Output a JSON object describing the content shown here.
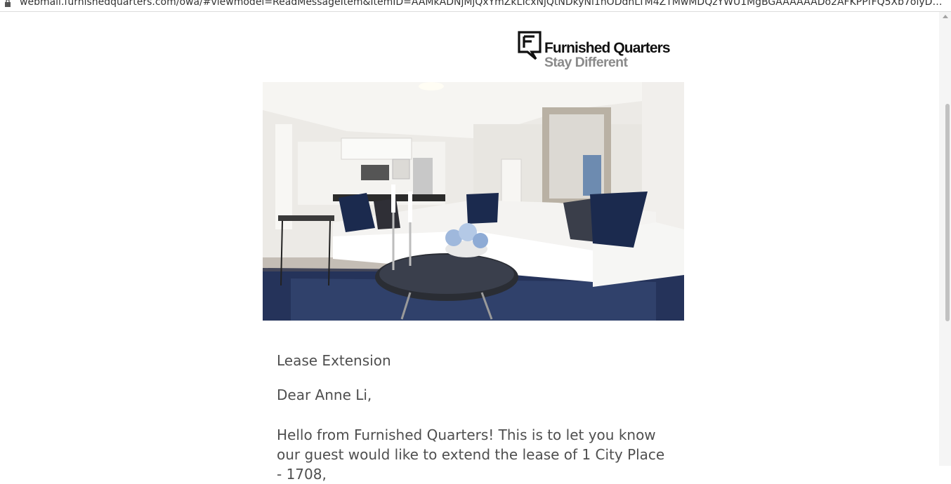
{
  "browser": {
    "url": "webmail.furnishedquarters.com/owa/#viewmodel=ReadMessageItem&ItemID=AAMkADNjMjQxYmZkLTcxNjQtNDkyNi1hODdhLTM4ZTMwMDQzYWU1MgBGAAAAAADo2AFKPPfFQ5Xb7oiyDbqOBwCEjdCSphIGTZ..."
  },
  "logo": {
    "brand": "Furnished Quarters",
    "tagline": "Stay Different"
  },
  "hero_image": {
    "description": "living-room"
  },
  "email": {
    "subject": "Lease Extension",
    "greeting": "Dear Anne Li,",
    "body": "Hello from Furnished Quarters! This is to let you know our guest would like to extend the lease of 1 City Place - 1708,"
  },
  "colors": {
    "text": "#4f4f4f",
    "logo_dark": "#111111",
    "logo_gray": "#8a8a8a",
    "navy_accent": "#1b2a4e"
  }
}
